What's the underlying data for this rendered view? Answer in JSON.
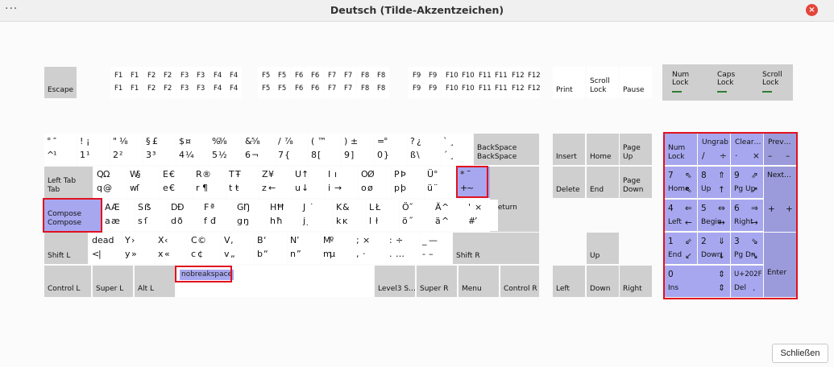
{
  "window": {
    "title": "Deutsch (Tilde-Akzentzeichen)",
    "menu_glyph": "···",
    "close_glyph": "×"
  },
  "footer": {
    "close_label": "Schließen"
  },
  "colors": {
    "key_white": "#ffffff",
    "key_gray": "#cfcfcf",
    "key_highlight": "#a7a7ef",
    "highlight_border": "#e0121f"
  },
  "leds": [
    {
      "label": "Num\nLock"
    },
    {
      "label": "Caps\nLock"
    },
    {
      "label": "Scroll\nLock"
    }
  ],
  "fn_row": {
    "escape": "Escape",
    "group1": [
      "F1",
      "F2",
      "F3",
      "F4"
    ],
    "group2": [
      "F5",
      "F6",
      "F7",
      "F8"
    ],
    "group3": [
      "F9",
      "F10",
      "F11",
      "F12"
    ],
    "print": "Print",
    "scroll": "Scroll\nLock",
    "pause": "Pause"
  },
  "row1": [
    [
      "°",
      "″",
      "^",
      "¹"
    ],
    [
      "!",
      "¡",
      "1",
      "¹"
    ],
    [
      "\"",
      "⅛",
      "2",
      "²"
    ],
    [
      "§",
      "£",
      "3",
      "³"
    ],
    [
      "$",
      "¤",
      "4",
      "¼"
    ],
    [
      "%",
      "⅜",
      "5",
      "½"
    ],
    [
      "&",
      "⅝",
      "6",
      "¬"
    ],
    [
      "/",
      "⅞",
      "7",
      "{"
    ],
    [
      "(",
      "™",
      "8",
      "["
    ],
    [
      ")",
      "±",
      "9",
      "]"
    ],
    [
      "=",
      "°",
      "0",
      "}"
    ],
    [
      "?",
      "¿",
      "ß",
      "\\"
    ],
    [
      "`",
      "¸",
      "´",
      "¸"
    ]
  ],
  "backspace": "BackSpace\nBackSpace",
  "tab": "Left Tab\nTab",
  "row2": [
    [
      "Q",
      "Ω",
      "q",
      "@"
    ],
    [
      "W",
      "§",
      "w",
      "ſ"
    ],
    [
      "E",
      "€",
      "e",
      "€"
    ],
    [
      "R",
      "®",
      "r",
      "¶"
    ],
    [
      "T",
      "Ŧ",
      "t",
      "ŧ"
    ],
    [
      "Z",
      "¥",
      "z",
      "←"
    ],
    [
      "U",
      "↑",
      "u",
      "↓"
    ],
    [
      "I",
      "ı",
      "i",
      "→"
    ],
    [
      "O",
      "Ø",
      "o",
      "ø"
    ],
    [
      "P",
      "Þ",
      "p",
      "þ"
    ],
    [
      "Ü",
      "°",
      "ü",
      "¨"
    ],
    [
      "*",
      "¯",
      "+",
      "~"
    ]
  ],
  "return": "Return",
  "compose": "Compose\nCompose",
  "row3": [
    [
      "A",
      "Æ",
      "a",
      "æ"
    ],
    [
      "S",
      "ẞ",
      "s",
      "ſ"
    ],
    [
      "D",
      "Ð",
      "d",
      "ð"
    ],
    [
      "F",
      "ª",
      "f",
      "đ"
    ],
    [
      "G",
      "Ŋ",
      "g",
      "ŋ"
    ],
    [
      "H",
      "Ħ",
      "h",
      "ħ"
    ],
    [
      "J",
      "˙",
      "j",
      "̣"
    ],
    [
      "K",
      "&",
      "k",
      "ĸ"
    ],
    [
      "L",
      "Ł",
      "l",
      "ł"
    ],
    [
      "Ö",
      "˝",
      "ö",
      "˝"
    ],
    [
      "Ä",
      "^",
      "ä",
      "^"
    ],
    [
      "'",
      "×",
      "#",
      "’"
    ]
  ],
  "shift_l": "Shift L",
  "row4": [
    [
      "dead",
      "",
      "<",
      "|"
    ],
    [
      "Y",
      "›",
      "y",
      "»"
    ],
    [
      "X",
      "‹",
      "x",
      "«"
    ],
    [
      "C",
      "©",
      "c",
      "¢"
    ],
    [
      "V",
      "‚",
      "v",
      "„"
    ],
    [
      "B",
      "‘",
      "b",
      "“"
    ],
    [
      "N",
      "’",
      "n",
      "”"
    ],
    [
      "M",
      "º",
      "m",
      "µ"
    ],
    [
      ";",
      "×",
      ",",
      "·"
    ],
    [
      ":",
      "÷",
      ".",
      "…"
    ],
    [
      "_",
      "—",
      "-",
      "–"
    ]
  ],
  "shift_r": "Shift R",
  "row5": {
    "ctrl_l": "Control L",
    "super_l": "Super L",
    "alt_l": "Alt L",
    "space": "nobreakspace",
    "level3": "Level3 S…",
    "super_r": "Super R",
    "menu": "Menu",
    "ctrl_r": "Control R"
  },
  "nav": {
    "insert": "Insert",
    "home": "Home",
    "pgup": "Page\nUp",
    "delete": "Delete",
    "end": "End",
    "pgdn": "Page\nDown",
    "up": "Up",
    "left": "Left",
    "down": "Down",
    "right": "Right"
  },
  "numpad": {
    "numlock": "Num\nLock",
    "div": [
      "Ungrab",
      "/",
      "÷"
    ],
    "mul": [
      "Clear…",
      "·",
      "×"
    ],
    "sub": [
      "Prev…",
      "–",
      "–"
    ],
    "n7": [
      "7",
      "⇖",
      "Home",
      "⇖"
    ],
    "n8": [
      "8",
      "⇑",
      "Up",
      "↑"
    ],
    "n9": [
      "9",
      "⇗",
      "Pg Up",
      "↗"
    ],
    "add": [
      "Next…",
      "+",
      "+"
    ],
    "n4": [
      "4",
      "⇐",
      "Left",
      "←"
    ],
    "n5": [
      "5",
      "⇔",
      "Begin",
      "↔"
    ],
    "n6": [
      "6",
      "⇒",
      "Right",
      "→"
    ],
    "n1": [
      "1",
      "⇙",
      "End",
      "↙"
    ],
    "n2": [
      "2",
      "⇓",
      "Down",
      "↓"
    ],
    "n3": [
      "3",
      "⇘",
      "Pg Dn",
      "↘"
    ],
    "n0": [
      "0",
      "⇕",
      "Ins",
      "⇕"
    ],
    "dec": [
      "U+202F",
      "Del",
      "."
    ],
    "enter": "Enter"
  }
}
